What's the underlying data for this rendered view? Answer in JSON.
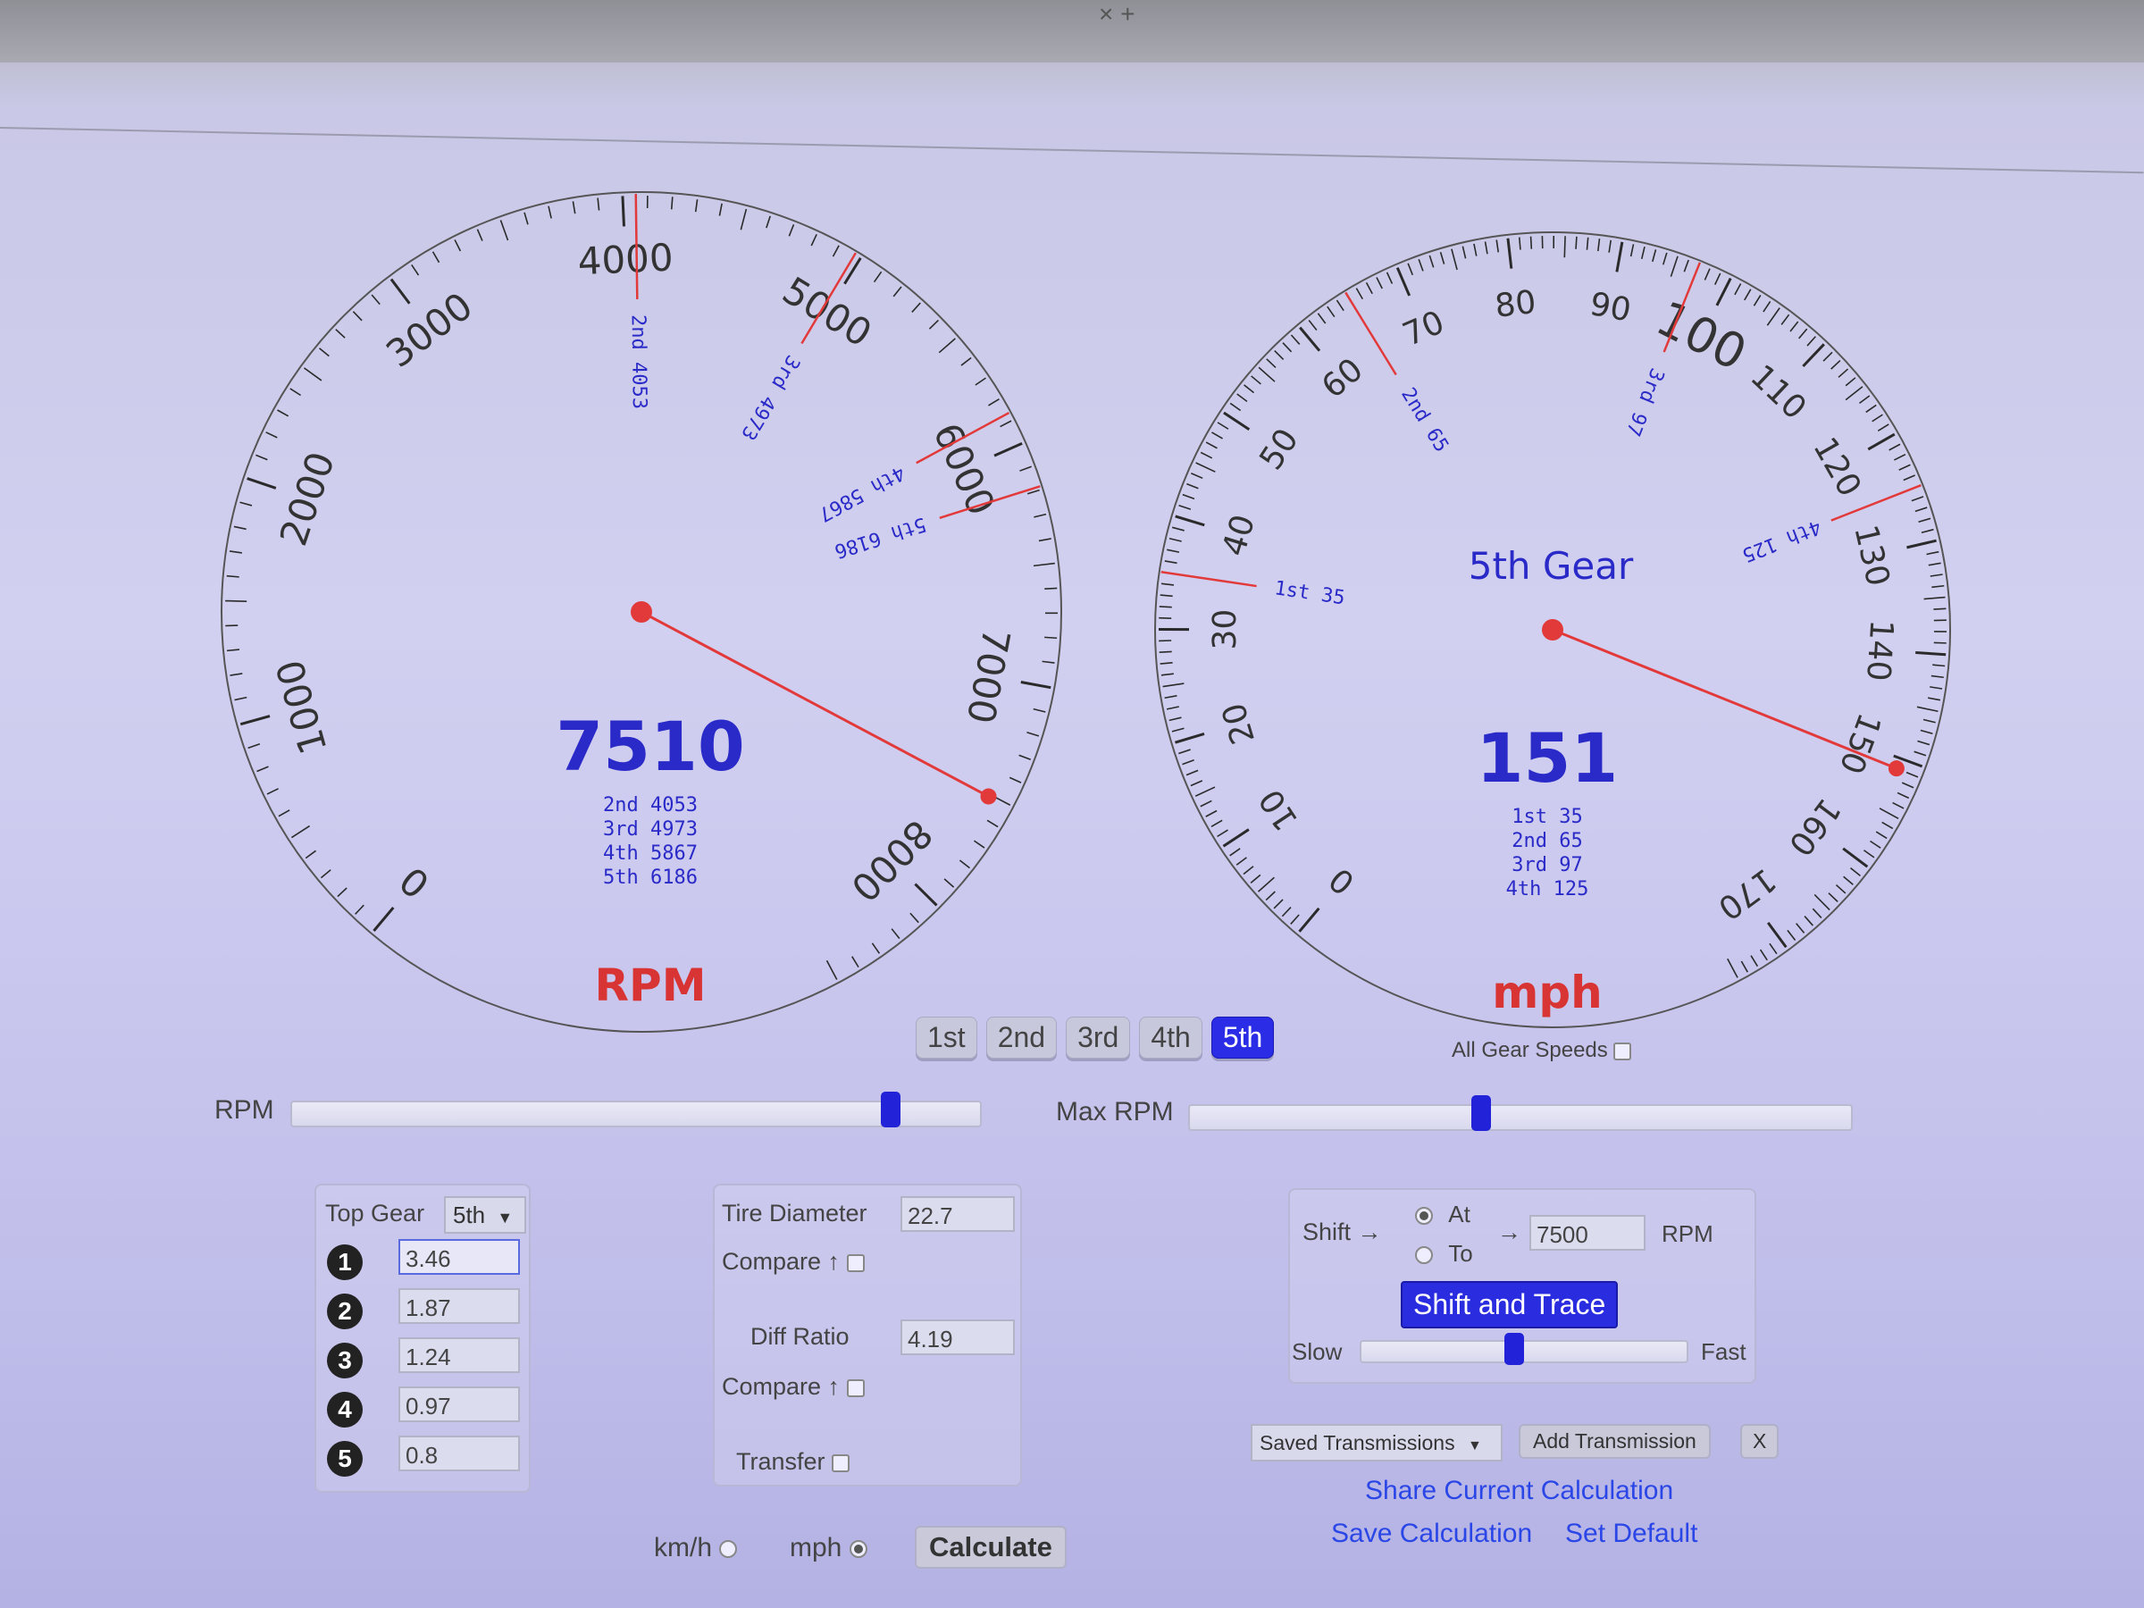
{
  "browser": {
    "hint": "×   +"
  },
  "rpm_gauge": {
    "tick_labels": [
      "0",
      "1000",
      "2000",
      "3000",
      "4000",
      "5000",
      "6000",
      "7000",
      "8000"
    ],
    "reading": "7510",
    "unit": "RPM",
    "shift_marks": [
      {
        "label": "2nd 4053",
        "value": 4053
      },
      {
        "label": "3rd 4973",
        "value": 4973
      },
      {
        "label": "4th 5867",
        "value": 5867
      },
      {
        "label": "5th 6186",
        "value": 6186
      }
    ],
    "needle_value": 7510,
    "list": [
      "2nd  4053",
      "3rd  4973",
      "4th  5867",
      "5th  6186"
    ]
  },
  "speed_gauge": {
    "tick_labels": [
      "0",
      "10",
      "20",
      "30",
      "40",
      "50",
      "60",
      "70",
      "80",
      "90",
      "100",
      "110",
      "120",
      "130",
      "140",
      "150",
      "160",
      "170"
    ],
    "gear_title": "5th Gear",
    "reading": "151",
    "unit": "mph",
    "shift_marks": [
      {
        "label": "1st 35",
        "value": 35
      },
      {
        "label": "2nd 65",
        "value": 65
      },
      {
        "label": "3rd 97",
        "value": 97
      },
      {
        "label": "4th 125",
        "value": 125
      }
    ],
    "needle_value": 151,
    "list": [
      "1st  35",
      "2nd  65",
      "3rd  97",
      "4th  125"
    ]
  },
  "gear_buttons": [
    "1st",
    "2nd",
    "3rd",
    "4th",
    "5th"
  ],
  "active_gear": "5th",
  "all_gear_speeds": {
    "label": "All Gear Speeds",
    "checked": false
  },
  "sliders": {
    "rpm_label": "RPM",
    "rpm_position": 0.87,
    "max_rpm_label": "Max RPM",
    "max_rpm_position": 0.44
  },
  "gears_panel": {
    "top_gear_label": "Top Gear",
    "top_gear_value": "5th",
    "ratios": [
      {
        "num": "1",
        "value": "3.46"
      },
      {
        "num": "2",
        "value": "1.87"
      },
      {
        "num": "3",
        "value": "1.24"
      },
      {
        "num": "4",
        "value": "0.97"
      },
      {
        "num": "5",
        "value": "0.8"
      }
    ]
  },
  "tire_panel": {
    "tire_label": "Tire Diameter",
    "tire_value": "22.7",
    "compare_label": "Compare ↑",
    "diff_label": "Diff Ratio",
    "diff_value": "4.19",
    "compare2_label": "Compare ↑",
    "transfer_label": "Transfer"
  },
  "shift_panel": {
    "shift_label": "Shift →",
    "at_label": "At",
    "to_label": "To",
    "arrow": "→",
    "rpm_value": "7500",
    "rpm_unit": "RPM",
    "trace_button": "Shift and Trace",
    "slow_label": "Slow",
    "fast_label": "Fast",
    "speed_position": 0.47
  },
  "saved": {
    "select_label": "Saved Transmissions",
    "add_button": "Add Transmission",
    "close_button": "X"
  },
  "links": {
    "share": "Share Current Calculation",
    "save": "Save Calculation",
    "default": "Set Default"
  },
  "units": {
    "kmh": "km/h",
    "mph": "mph",
    "calculate": "Calculate"
  },
  "colors": {
    "accent": "#2a2ce6",
    "needle": "#e23a3a",
    "gauge_text": "#2a2ac8",
    "unit_red": "#d83434"
  }
}
